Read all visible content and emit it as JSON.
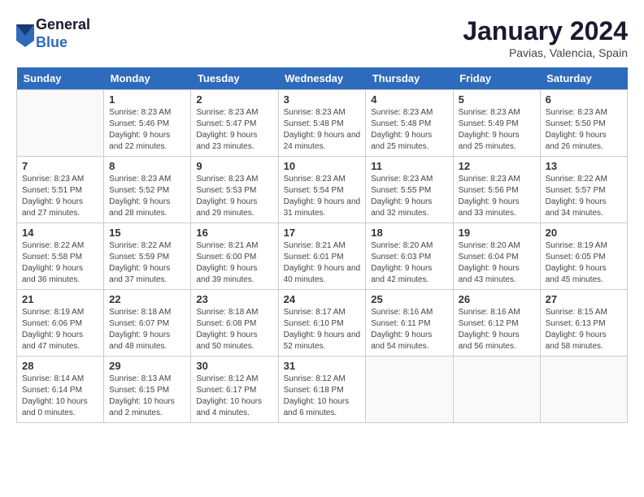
{
  "header": {
    "logo_general": "General",
    "logo_blue": "Blue",
    "month_title": "January 2024",
    "location": "Pavias, Valencia, Spain"
  },
  "weekdays": [
    "Sunday",
    "Monday",
    "Tuesday",
    "Wednesday",
    "Thursday",
    "Friday",
    "Saturday"
  ],
  "weeks": [
    [
      {
        "day": "",
        "sunrise": "",
        "sunset": "",
        "daylight": ""
      },
      {
        "day": "1",
        "sunrise": "Sunrise: 8:23 AM",
        "sunset": "Sunset: 5:46 PM",
        "daylight": "Daylight: 9 hours and 22 minutes."
      },
      {
        "day": "2",
        "sunrise": "Sunrise: 8:23 AM",
        "sunset": "Sunset: 5:47 PM",
        "daylight": "Daylight: 9 hours and 23 minutes."
      },
      {
        "day": "3",
        "sunrise": "Sunrise: 8:23 AM",
        "sunset": "Sunset: 5:48 PM",
        "daylight": "Daylight: 9 hours and 24 minutes."
      },
      {
        "day": "4",
        "sunrise": "Sunrise: 8:23 AM",
        "sunset": "Sunset: 5:48 PM",
        "daylight": "Daylight: 9 hours and 25 minutes."
      },
      {
        "day": "5",
        "sunrise": "Sunrise: 8:23 AM",
        "sunset": "Sunset: 5:49 PM",
        "daylight": "Daylight: 9 hours and 25 minutes."
      },
      {
        "day": "6",
        "sunrise": "Sunrise: 8:23 AM",
        "sunset": "Sunset: 5:50 PM",
        "daylight": "Daylight: 9 hours and 26 minutes."
      }
    ],
    [
      {
        "day": "7",
        "sunrise": "Sunrise: 8:23 AM",
        "sunset": "Sunset: 5:51 PM",
        "daylight": "Daylight: 9 hours and 27 minutes."
      },
      {
        "day": "8",
        "sunrise": "Sunrise: 8:23 AM",
        "sunset": "Sunset: 5:52 PM",
        "daylight": "Daylight: 9 hours and 28 minutes."
      },
      {
        "day": "9",
        "sunrise": "Sunrise: 8:23 AM",
        "sunset": "Sunset: 5:53 PM",
        "daylight": "Daylight: 9 hours and 29 minutes."
      },
      {
        "day": "10",
        "sunrise": "Sunrise: 8:23 AM",
        "sunset": "Sunset: 5:54 PM",
        "daylight": "Daylight: 9 hours and 31 minutes."
      },
      {
        "day": "11",
        "sunrise": "Sunrise: 8:23 AM",
        "sunset": "Sunset: 5:55 PM",
        "daylight": "Daylight: 9 hours and 32 minutes."
      },
      {
        "day": "12",
        "sunrise": "Sunrise: 8:23 AM",
        "sunset": "Sunset: 5:56 PM",
        "daylight": "Daylight: 9 hours and 33 minutes."
      },
      {
        "day": "13",
        "sunrise": "Sunrise: 8:22 AM",
        "sunset": "Sunset: 5:57 PM",
        "daylight": "Daylight: 9 hours and 34 minutes."
      }
    ],
    [
      {
        "day": "14",
        "sunrise": "Sunrise: 8:22 AM",
        "sunset": "Sunset: 5:58 PM",
        "daylight": "Daylight: 9 hours and 36 minutes."
      },
      {
        "day": "15",
        "sunrise": "Sunrise: 8:22 AM",
        "sunset": "Sunset: 5:59 PM",
        "daylight": "Daylight: 9 hours and 37 minutes."
      },
      {
        "day": "16",
        "sunrise": "Sunrise: 8:21 AM",
        "sunset": "Sunset: 6:00 PM",
        "daylight": "Daylight: 9 hours and 39 minutes."
      },
      {
        "day": "17",
        "sunrise": "Sunrise: 8:21 AM",
        "sunset": "Sunset: 6:01 PM",
        "daylight": "Daylight: 9 hours and 40 minutes."
      },
      {
        "day": "18",
        "sunrise": "Sunrise: 8:20 AM",
        "sunset": "Sunset: 6:03 PM",
        "daylight": "Daylight: 9 hours and 42 minutes."
      },
      {
        "day": "19",
        "sunrise": "Sunrise: 8:20 AM",
        "sunset": "Sunset: 6:04 PM",
        "daylight": "Daylight: 9 hours and 43 minutes."
      },
      {
        "day": "20",
        "sunrise": "Sunrise: 8:19 AM",
        "sunset": "Sunset: 6:05 PM",
        "daylight": "Daylight: 9 hours and 45 minutes."
      }
    ],
    [
      {
        "day": "21",
        "sunrise": "Sunrise: 8:19 AM",
        "sunset": "Sunset: 6:06 PM",
        "daylight": "Daylight: 9 hours and 47 minutes."
      },
      {
        "day": "22",
        "sunrise": "Sunrise: 8:18 AM",
        "sunset": "Sunset: 6:07 PM",
        "daylight": "Daylight: 9 hours and 48 minutes."
      },
      {
        "day": "23",
        "sunrise": "Sunrise: 8:18 AM",
        "sunset": "Sunset: 6:08 PM",
        "daylight": "Daylight: 9 hours and 50 minutes."
      },
      {
        "day": "24",
        "sunrise": "Sunrise: 8:17 AM",
        "sunset": "Sunset: 6:10 PM",
        "daylight": "Daylight: 9 hours and 52 minutes."
      },
      {
        "day": "25",
        "sunrise": "Sunrise: 8:16 AM",
        "sunset": "Sunset: 6:11 PM",
        "daylight": "Daylight: 9 hours and 54 minutes."
      },
      {
        "day": "26",
        "sunrise": "Sunrise: 8:16 AM",
        "sunset": "Sunset: 6:12 PM",
        "daylight": "Daylight: 9 hours and 56 minutes."
      },
      {
        "day": "27",
        "sunrise": "Sunrise: 8:15 AM",
        "sunset": "Sunset: 6:13 PM",
        "daylight": "Daylight: 9 hours and 58 minutes."
      }
    ],
    [
      {
        "day": "28",
        "sunrise": "Sunrise: 8:14 AM",
        "sunset": "Sunset: 6:14 PM",
        "daylight": "Daylight: 10 hours and 0 minutes."
      },
      {
        "day": "29",
        "sunrise": "Sunrise: 8:13 AM",
        "sunset": "Sunset: 6:15 PM",
        "daylight": "Daylight: 10 hours and 2 minutes."
      },
      {
        "day": "30",
        "sunrise": "Sunrise: 8:12 AM",
        "sunset": "Sunset: 6:17 PM",
        "daylight": "Daylight: 10 hours and 4 minutes."
      },
      {
        "day": "31",
        "sunrise": "Sunrise: 8:12 AM",
        "sunset": "Sunset: 6:18 PM",
        "daylight": "Daylight: 10 hours and 6 minutes."
      },
      {
        "day": "",
        "sunrise": "",
        "sunset": "",
        "daylight": ""
      },
      {
        "day": "",
        "sunrise": "",
        "sunset": "",
        "daylight": ""
      },
      {
        "day": "",
        "sunrise": "",
        "sunset": "",
        "daylight": ""
      }
    ]
  ]
}
